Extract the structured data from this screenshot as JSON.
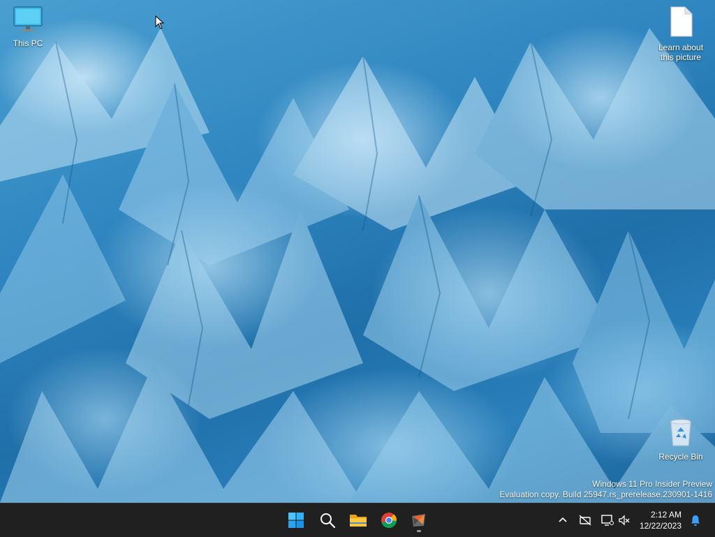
{
  "desktop": {
    "icons": [
      {
        "label": "This PC",
        "icon": "monitor-icon"
      },
      {
        "label": "Learn about this picture",
        "icon": "document-icon"
      },
      {
        "label": "Recycle Bin",
        "icon": "recycle-bin-icon"
      }
    ],
    "watermark": {
      "line1": "Windows 11 Pro Insider Preview",
      "line2": "Evaluation copy. Build 25947.rs_prerelease.230901-1416"
    }
  },
  "taskbar": {
    "apps": [
      {
        "name": "start",
        "icon": "windows-logo-icon"
      },
      {
        "name": "search",
        "icon": "search-icon"
      },
      {
        "name": "file-explorer",
        "icon": "folder-icon"
      },
      {
        "name": "chrome",
        "icon": "chrome-icon"
      },
      {
        "name": "app",
        "icon": "app-icon",
        "active": true
      }
    ],
    "tray": {
      "icons": [
        "chevron-up-icon",
        "network-disconnected-icon",
        "display-icon",
        "volume-muted-icon",
        "notification-bell-icon"
      ],
      "time": "2:12 AM",
      "date": "12/22/2023"
    }
  },
  "colors": {
    "taskbar_bg": "#202020",
    "accent": "#0078d4",
    "bell_accent": "#3aa0ff"
  }
}
